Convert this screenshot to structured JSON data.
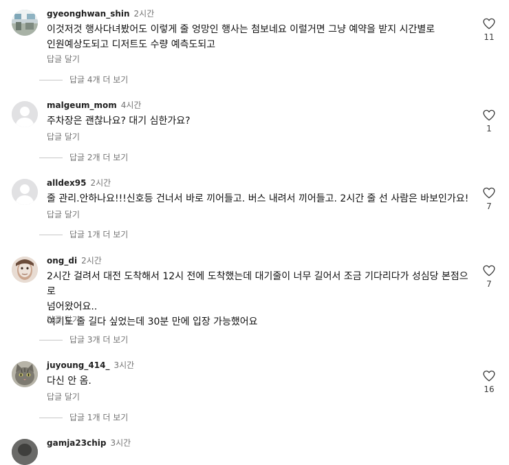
{
  "comments": [
    {
      "username": "gyeonghwan_shin",
      "time": "2시간",
      "text": "이것저것 행사다녀봤어도 이렇게 줄 엉망인 행사는 첨보네요 이럴거면 그냥 예약을 받지 시간별로\n인원예상도되고 디저트도 수량 예측도되고",
      "reply": "답글 달기",
      "more_replies": "답글 4개 더 보기",
      "likes": "11",
      "avatar": "room-photo"
    },
    {
      "username": "malgeum_mom",
      "time": "4시간",
      "text": "주차장은 괜찮나요? 대기 심한가요?",
      "reply": "답글 달기",
      "more_replies": "답글 2개 더 보기",
      "likes": "1",
      "avatar": "default-profile"
    },
    {
      "username": "alldex95",
      "time": "2시간",
      "text": "줄 관리.안하나요!!!신호등 건너서 바로 끼어들고. 버스 내려서 끼어들고. 2시간 줄 선 사람은 바보인가요!",
      "reply": "답글 달기",
      "more_replies": "답글 1개 더 보기",
      "likes": "7",
      "avatar": "default-profile"
    },
    {
      "username": "ong_di",
      "time": "2시간",
      "text": "2시간 걸려서 대전 도착해서 12시 전에 도착했는데 대기줄이 너무 길어서 조금 기다리다가 성심당 본점으로\n넘어왔어요..\n여기도 줄 길다 싶었는데 30분 만에 입장 가능했어요",
      "reply": "답글 달기",
      "more_replies": "답글 3개 더 보기",
      "likes": "7",
      "avatar": "face-photo"
    },
    {
      "username": "juyoung_414_",
      "time": "3시간",
      "text": "다신 안 옴.",
      "reply": "답글 달기",
      "more_replies": "답글 1개 더 보기",
      "likes": "16",
      "avatar": "cat-photo"
    },
    {
      "username": "gamja23chip",
      "time": "3시간",
      "text": "",
      "reply": "",
      "more_replies": "",
      "likes": "",
      "avatar": "photo"
    }
  ],
  "colors": {
    "username": "#1f1f1f",
    "secondary_text": "#737373",
    "body_text": "#0f0f0f",
    "divider": "#c7c7c7",
    "default_avatar": "#e1e1e3"
  },
  "icons": {
    "like": "heart-outline-icon",
    "default_avatar": "person-silhouette-icon"
  }
}
